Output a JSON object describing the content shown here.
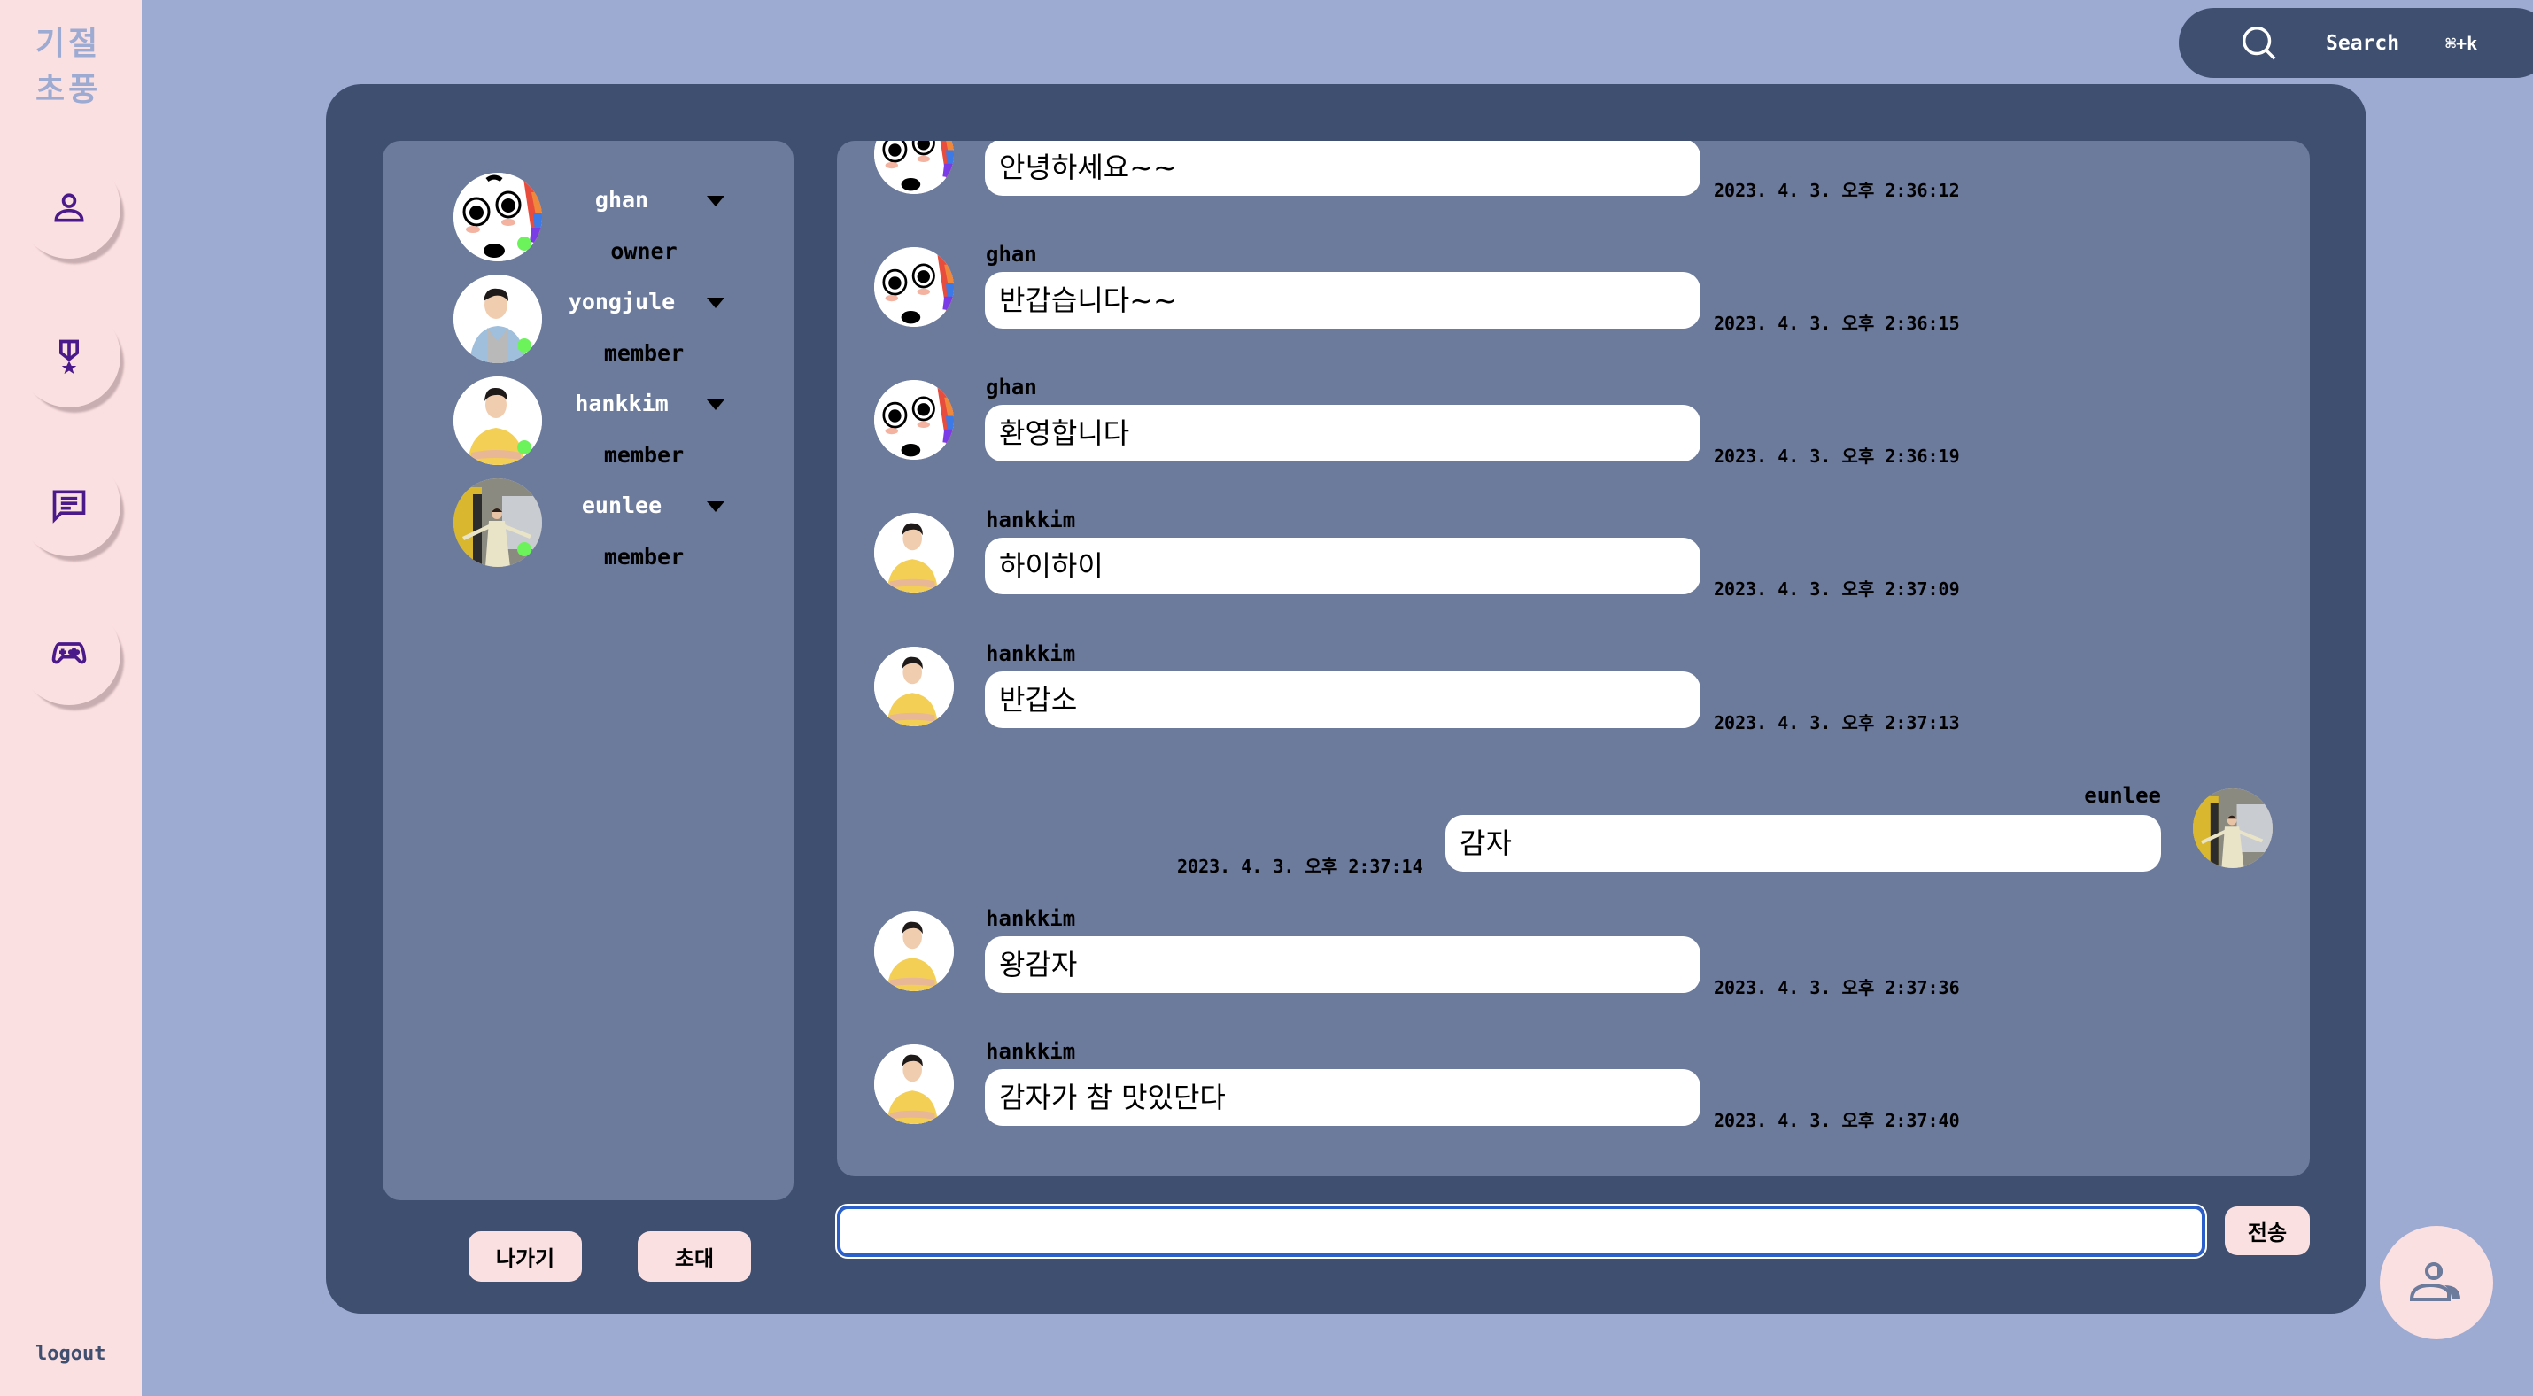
{
  "sidebar": {
    "logo_line1": "기절",
    "logo_line2": "초풍",
    "nav": [
      {
        "icon": "user-icon",
        "label": "profile"
      },
      {
        "icon": "medal-icon",
        "label": "ranking"
      },
      {
        "icon": "chat-icon",
        "label": "chat"
      },
      {
        "icon": "gamepad-icon",
        "label": "game"
      }
    ],
    "logout_label": "logout"
  },
  "search": {
    "label": "Search",
    "shortcut": "⌘+k"
  },
  "members": [
    {
      "name": "ghan",
      "role": "owner",
      "online": true,
      "avatar": "ghan"
    },
    {
      "name": "yongjule",
      "role": "member",
      "online": true,
      "avatar": "yongjule"
    },
    {
      "name": "hankkim",
      "role": "member",
      "online": true,
      "avatar": "hankkim"
    },
    {
      "name": "eunlee",
      "role": "member",
      "online": true,
      "avatar": "eunlee"
    }
  ],
  "actions": {
    "leave_label": "나가기",
    "invite_label": "초대"
  },
  "messages": [
    {
      "sender": "ghan",
      "text": "안녕하세요~~",
      "time": "2023. 4. 3. 오후 2:36:12",
      "mine": false
    },
    {
      "sender": "ghan",
      "text": "반갑습니다~~",
      "time": "2023. 4. 3. 오후 2:36:15",
      "mine": false
    },
    {
      "sender": "ghan",
      "text": "환영합니다",
      "time": "2023. 4. 3. 오후 2:36:19",
      "mine": false
    },
    {
      "sender": "hankkim",
      "text": "하이하이",
      "time": "2023. 4. 3. 오후 2:37:09",
      "mine": false
    },
    {
      "sender": "hankkim",
      "text": "반갑소",
      "time": "2023. 4. 3. 오후 2:37:13",
      "mine": false
    },
    {
      "sender": "eunlee",
      "text": "감자",
      "time": "2023. 4. 3. 오후 2:37:14",
      "mine": true
    },
    {
      "sender": "hankkim",
      "text": "왕감자",
      "time": "2023. 4. 3. 오후 2:37:36",
      "mine": false
    },
    {
      "sender": "hankkim",
      "text": "감자가 참 맛있단다",
      "time": "2023. 4. 3. 오후 2:37:40",
      "mine": false
    }
  ],
  "composer": {
    "value": "",
    "placeholder": "",
    "send_label": "전송"
  },
  "colors": {
    "background": "#9daad2",
    "sidebar": "#fbe0e1",
    "panel": "#3f4f70",
    "inner_panel": "#6c7a9c",
    "icon_purple": "#4a1a8a",
    "online": "#6cf25a",
    "input_focus": "#2b5fc9"
  }
}
